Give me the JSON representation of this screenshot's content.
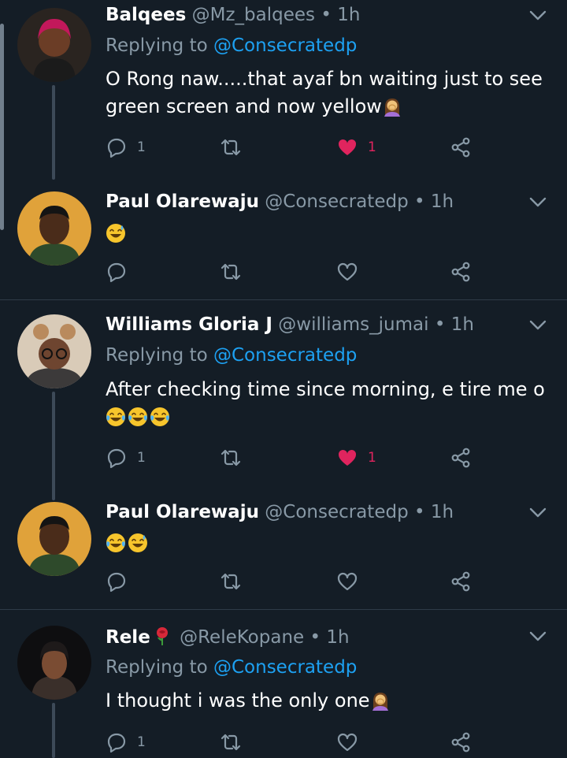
{
  "tweets": [
    {
      "name": "Balqees",
      "handle": "@Mz_balqees",
      "dot": "•",
      "time": "1h",
      "replying_prefix": "Replying to",
      "replying_to": "@Consecratedp",
      "text": "O Rong naw.....that ayaf bn waiting just to see green screen and now yellow",
      "emojis": [
        "woman-facepalming-emoji"
      ],
      "reply_count": "1",
      "like_count": "1",
      "liked": true
    },
    {
      "name": "Paul Olarewaju",
      "handle": "@Consecratedp",
      "dot": "•",
      "time": "1h",
      "text": "",
      "emojis": [
        "grinning-sweat-emoji"
      ],
      "reply_count": "",
      "like_count": "",
      "liked": false
    },
    {
      "name": "Williams Gloria J",
      "handle": "@williams_jumai",
      "dot": "•",
      "time": "1h",
      "replying_prefix": "Replying to",
      "replying_to": "@Consecratedp",
      "text": "After checking time since morning, e tire me o",
      "emojis": [
        "tears-of-joy-emoji",
        "tears-of-joy-emoji",
        "tears-of-joy-emoji"
      ],
      "reply_count": "1",
      "like_count": "1",
      "liked": true
    },
    {
      "name": "Paul Olarewaju",
      "handle": "@Consecratedp",
      "dot": "•",
      "time": "1h",
      "text": "",
      "emojis": [
        "tears-of-joy-emoji",
        "grinning-sweat-emoji"
      ],
      "reply_count": "",
      "like_count": "",
      "liked": false
    },
    {
      "name": "Rele",
      "name_emoji": "rose-emoji",
      "handle": "@ReleKopane",
      "dot": "•",
      "time": "1h",
      "replying_prefix": "Replying to",
      "replying_to": "@Consecratedp",
      "text": "I thought i was the only one",
      "emojis": [
        "woman-facepalming-emoji"
      ],
      "reply_count": "1",
      "like_count": "",
      "liked": false
    }
  ],
  "colors": {
    "background": "#141d26",
    "secondary_text": "#8899a6",
    "link": "#1da1f2",
    "like": "#e0245e",
    "separator": "#2f3b48"
  }
}
